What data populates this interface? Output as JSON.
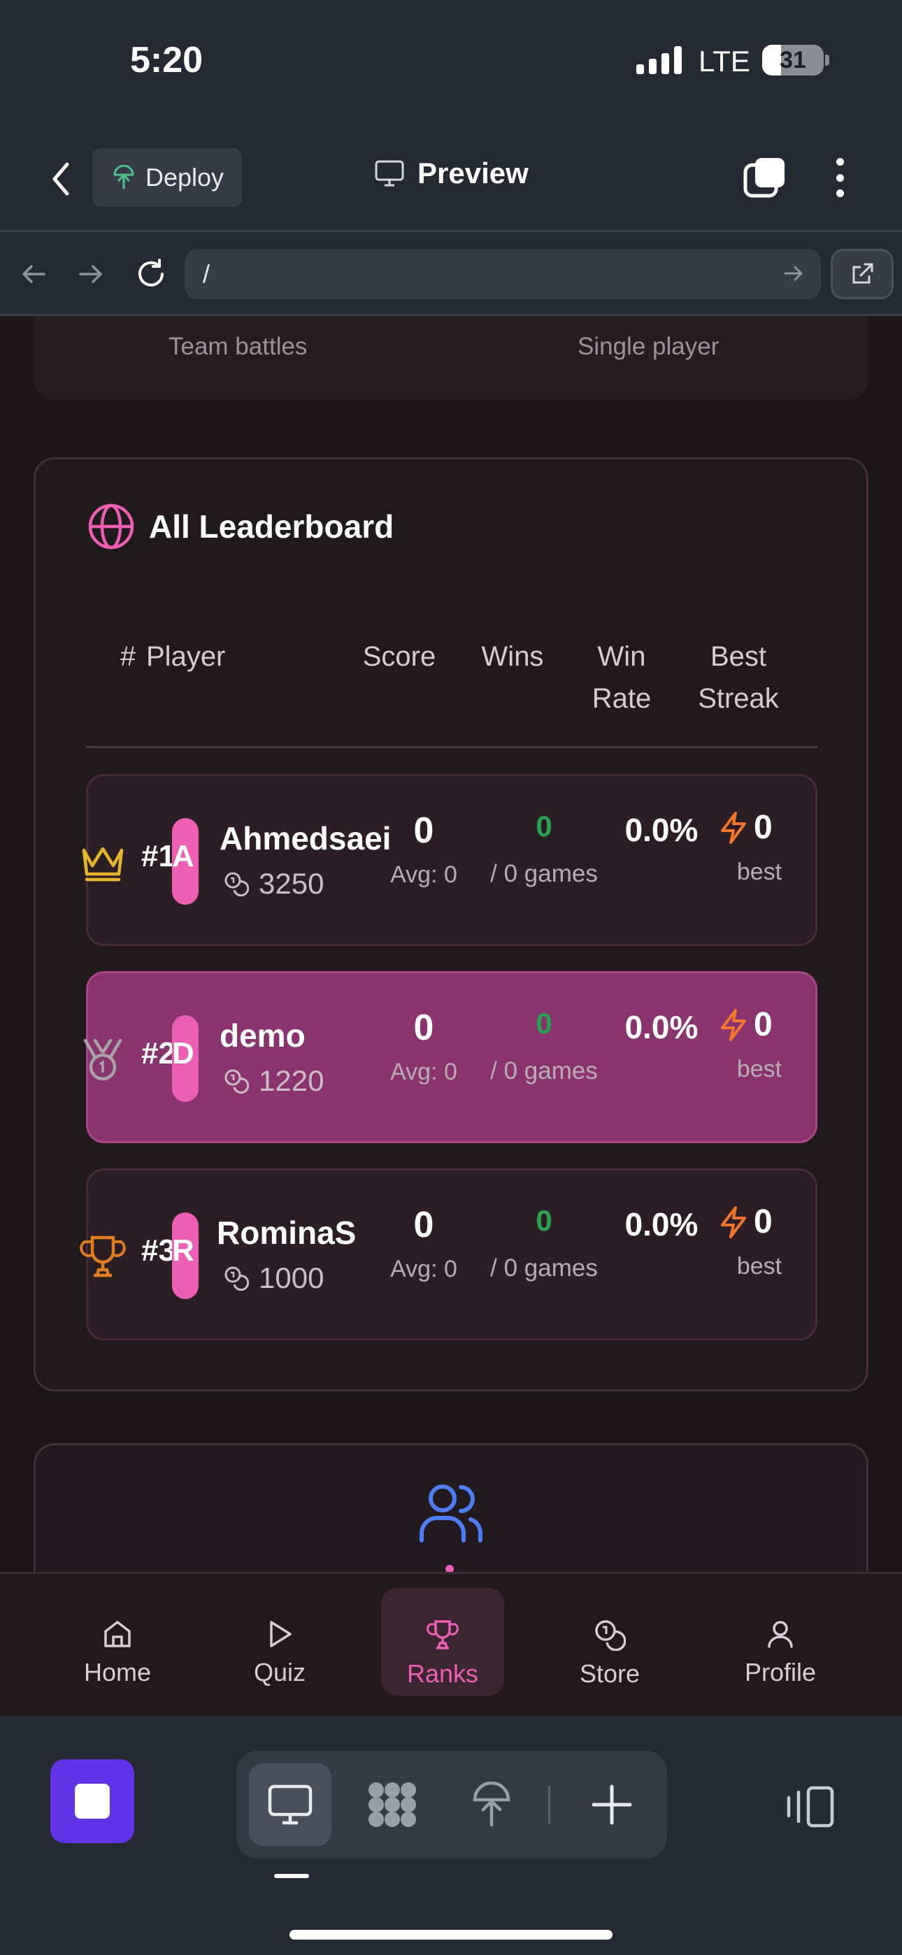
{
  "status": {
    "time": "5:20",
    "network": "LTE",
    "battery": "31",
    "battery_level": 0.31
  },
  "toolbar": {
    "deploy_label": "Deploy",
    "preview_label": "Preview"
  },
  "urlbar": {
    "url": "/"
  },
  "modes": {
    "left": "Team battles",
    "right": "Single player"
  },
  "leaderboard": {
    "title": "All Leaderboard",
    "columns": {
      "rank": "#",
      "player": "Player",
      "score": "Score",
      "wins": "Wins",
      "win_rate": "Win Rate",
      "best_streak": "Best Streak"
    },
    "rows": [
      {
        "rank": "#1",
        "icon": "crown-icon",
        "initial": "A",
        "name": "Ahmedsaei",
        "coins": "3250",
        "score": "0",
        "avg": "Avg: 0",
        "wins": "0",
        "wins_sub": "/ 0 games",
        "win_rate": "0.0%",
        "streak": "0",
        "streak_sub": "best",
        "highlight": false
      },
      {
        "rank": "#2",
        "icon": "medal-icon",
        "initial": "D",
        "name": "demo",
        "coins": "1220",
        "score": "0",
        "avg": "Avg: 0",
        "wins": "0",
        "wins_sub": "/ 0 games",
        "win_rate": "0.0%",
        "streak": "0",
        "streak_sub": "best",
        "highlight": true
      },
      {
        "rank": "#3",
        "icon": "trophy-icon",
        "initial": "R",
        "name": "RominaS",
        "coins": "1000",
        "score": "0",
        "avg": "Avg: 0",
        "wins": "0",
        "wins_sub": "/ 0 games",
        "win_rate": "0.0%",
        "streak": "0",
        "streak_sub": "best",
        "highlight": false
      }
    ]
  },
  "app_nav": [
    {
      "label": "Home",
      "icon": "home-icon",
      "active": false
    },
    {
      "label": "Quiz",
      "icon": "play-icon",
      "active": false
    },
    {
      "label": "Ranks",
      "icon": "trophy-icon",
      "active": true
    },
    {
      "label": "Store",
      "icon": "coins-icon",
      "active": false
    },
    {
      "label": "Profile",
      "icon": "user-icon",
      "active": false
    }
  ],
  "colors": {
    "accent": "#ec5fb4",
    "win_green": "#26a34f",
    "streak_orange": "#f2772a",
    "crown_gold": "#e8b62a",
    "trophy_orange": "#e07d1f",
    "deploy_purple": "#6133e8"
  }
}
